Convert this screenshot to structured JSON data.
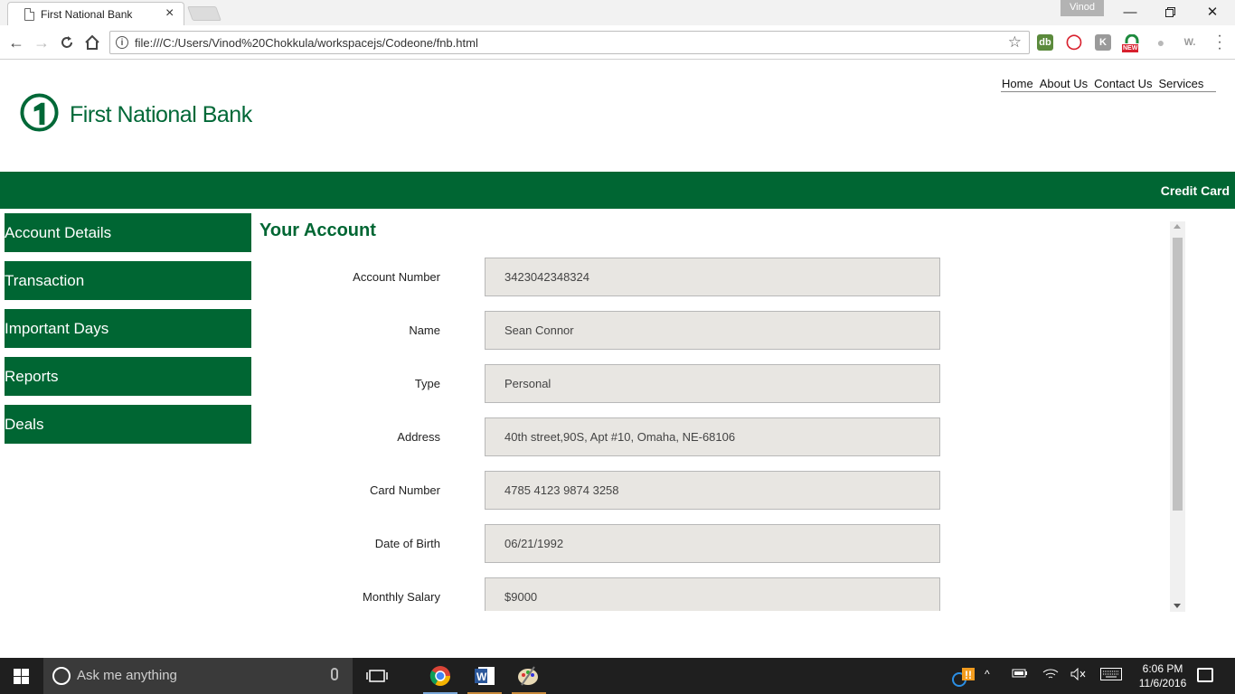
{
  "browser": {
    "tab_title": "First National Bank",
    "url": "file:///C:/Users/Vinod%20Chokkula/workspacejs/Codeone/fnb.html",
    "profile_name": "Vinod",
    "extensions": [
      {
        "name": "db-extension-icon",
        "label": "db",
        "color": "#5b8a3c"
      },
      {
        "name": "opera-extension-icon",
        "label": "O",
        "color": "#d8212e"
      },
      {
        "name": "k-extension-icon",
        "label": "K",
        "color": "#9a9a9a"
      },
      {
        "name": "headphones-extension-icon",
        "label": "",
        "color": "#1e8a3e"
      },
      {
        "name": "balloon-extension-icon",
        "label": "",
        "color": "#b8b8b8"
      },
      {
        "name": "w-extension-icon",
        "label": "W.",
        "color": "#9a9a9a"
      }
    ],
    "new_badge": "NEW"
  },
  "site": {
    "brand": "First National Bank",
    "brand_color": "#006633",
    "nav": [
      "Home",
      "About Us",
      "Contact Us",
      "Services"
    ],
    "banner_link": "Credit Card"
  },
  "sidebar": {
    "items": [
      "Account Details",
      "Transaction",
      "Important Days",
      "Reports",
      "Deals"
    ]
  },
  "account": {
    "heading": "Your Account",
    "fields": [
      {
        "label": "Account Number",
        "value": "3423042348324"
      },
      {
        "label": "Name",
        "value": "Sean Connor"
      },
      {
        "label": "Type",
        "value": "Personal"
      },
      {
        "label": "Address",
        "value": "40th street,90S, Apt #10, Omaha, NE-68106"
      },
      {
        "label": "Card Number",
        "value": "4785 4123 9874 3258"
      },
      {
        "label": "Date of Birth",
        "value": "06/21/1992"
      },
      {
        "label": "Monthly Salary",
        "value": "$9000"
      }
    ]
  },
  "taskbar": {
    "search_placeholder": "Ask me anything",
    "time": "6:06 PM",
    "date": "11/6/2016"
  }
}
